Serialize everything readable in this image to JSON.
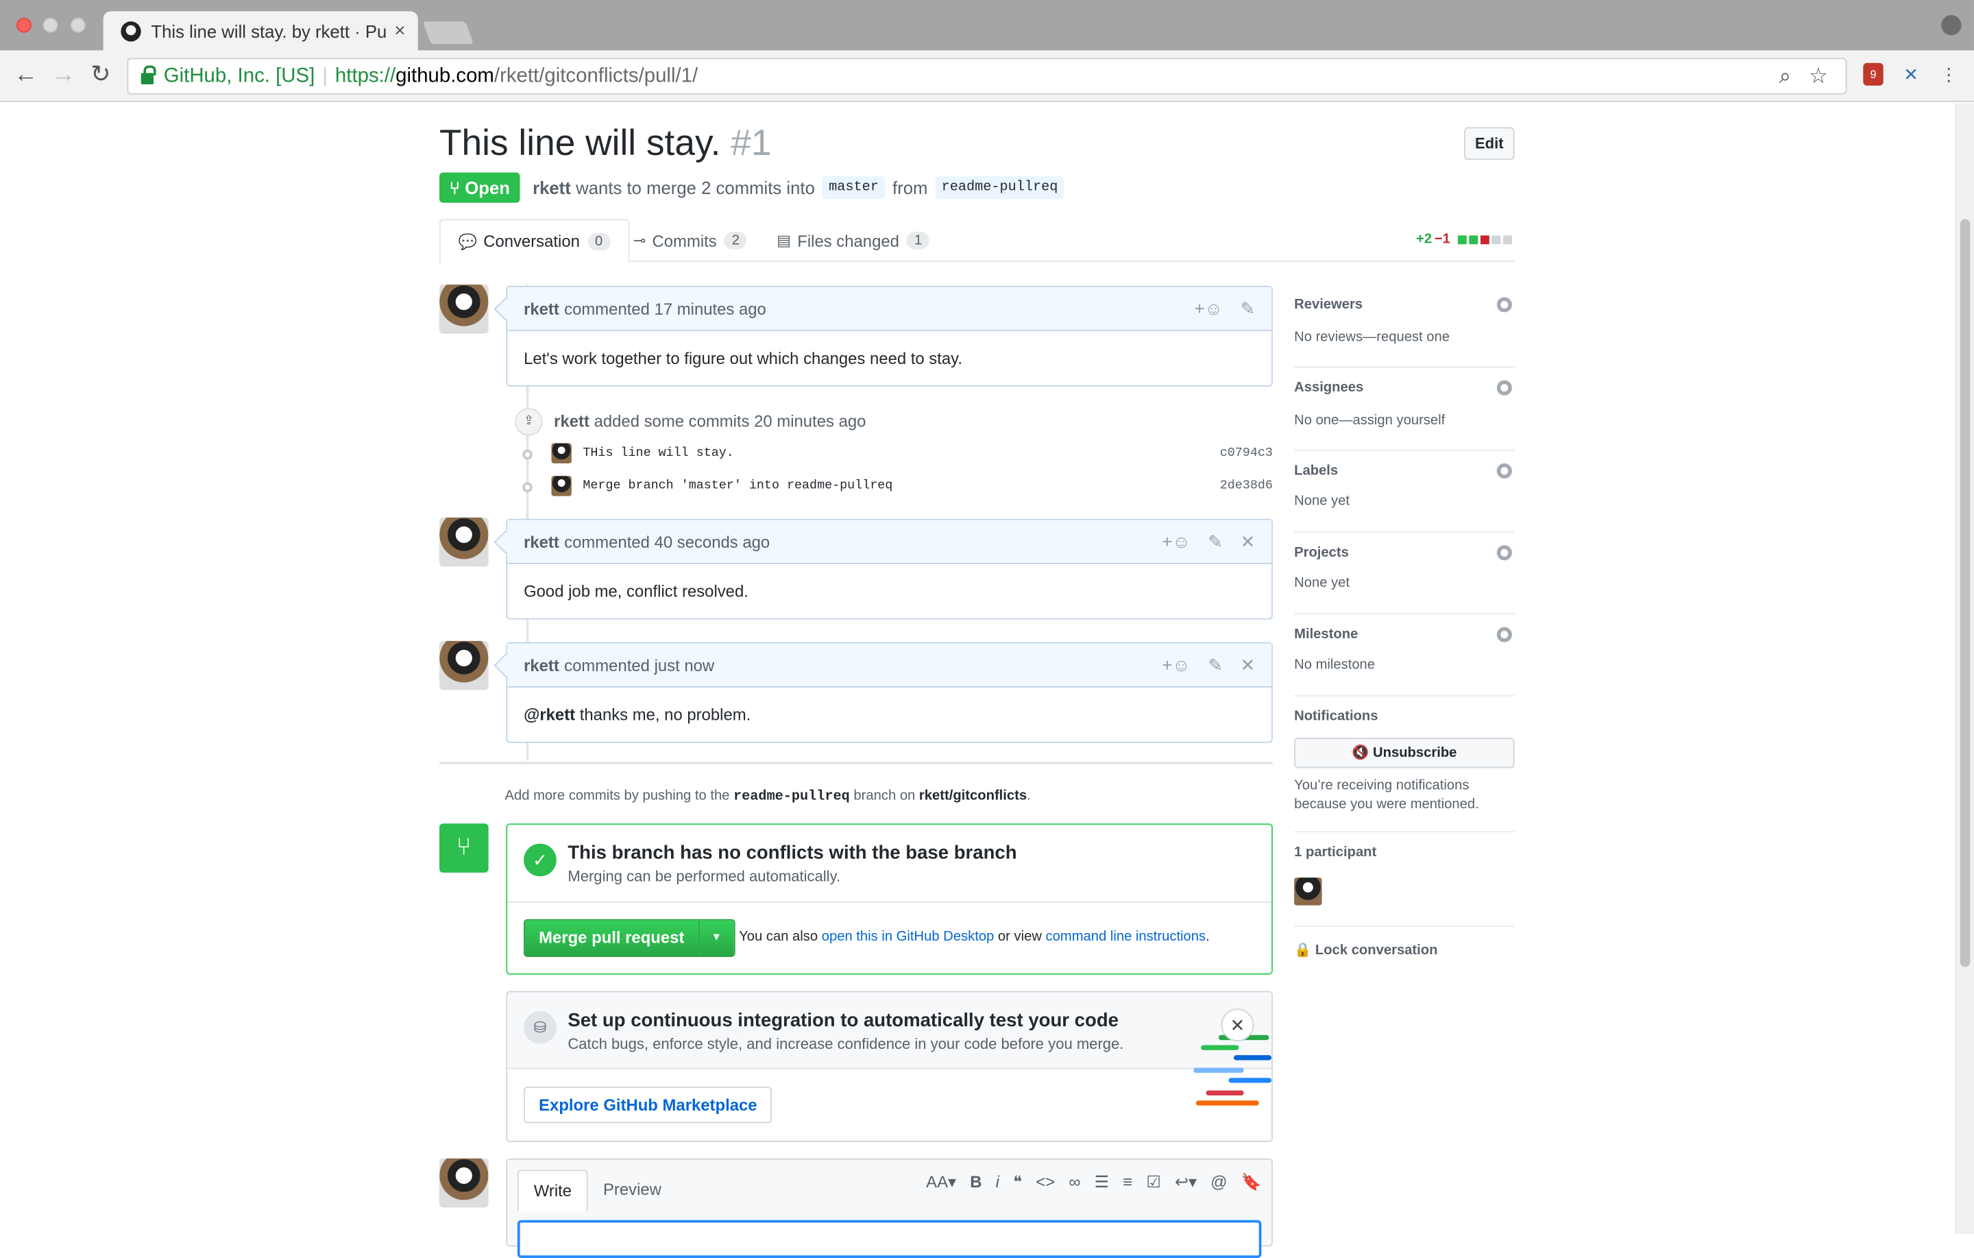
{
  "browser": {
    "tab_title": "This line will stay. by rkett · Pul",
    "tab_close": "×",
    "secure_label": "GitHub, Inc. [US]",
    "url_scheme": "https://",
    "url_host": "github.com",
    "url_path": "/rkett/gitconflicts/pull/1/",
    "ext_badge": "9"
  },
  "pr": {
    "title": "This line will stay.",
    "number": "#1",
    "edit_label": "Edit",
    "state": "Open",
    "author": "rkett",
    "merge_text": "wants to merge 2 commits into",
    "base_branch": "master",
    "from_text": "from",
    "head_branch": "readme-pullreq"
  },
  "tabs": [
    {
      "label": "Conversation",
      "count": "0"
    },
    {
      "label": "Commits",
      "count": "2"
    },
    {
      "label": "Files changed",
      "count": "1"
    }
  ],
  "diffstat": {
    "additions": "+2",
    "deletions": "−1"
  },
  "comments": [
    {
      "author": "rkett",
      "meta": "commented 17 minutes ago",
      "body": "Let's work together to figure out which changes need to stay."
    },
    {
      "author": "rkett",
      "meta": "commented 40 seconds ago",
      "body": "Good job me, conflict resolved."
    },
    {
      "author": "rkett",
      "meta": "commented just now",
      "mention": "@rkett",
      "body": " thanks me, no problem."
    }
  ],
  "commits": {
    "author": "rkett",
    "summary": "added some commits 20 minutes ago",
    "items": [
      {
        "message": "THis line will stay.",
        "sha": "c0794c3"
      },
      {
        "message": "Merge branch 'master' into readme-pullreq",
        "sha": "2de38d6"
      }
    ]
  },
  "push_note": {
    "prefix": "Add more commits by pushing to the",
    "branch": "readme-pullreq",
    "middle": "branch on",
    "repo": "rkett/gitconflicts",
    "suffix": "."
  },
  "merge": {
    "heading": "This branch has no conflicts with the base branch",
    "sub": "Merging can be performed automatically.",
    "button": "Merge pull request",
    "alt_prefix": "You can also",
    "alt_link1": "open this in GitHub Desktop",
    "alt_middle": "or view",
    "alt_link2": "command line instructions",
    "alt_suffix": "."
  },
  "ci": {
    "heading": "Set up continuous integration to automatically test your code",
    "sub": "Catch bugs, enforce style, and increase confidence in your code before you merge.",
    "button": "Explore GitHub Marketplace"
  },
  "composer": {
    "write_tab": "Write",
    "preview_tab": "Preview"
  },
  "sidebar": {
    "reviewers": {
      "heading": "Reviewers",
      "value": "No reviews—request one"
    },
    "assignees": {
      "heading": "Assignees",
      "value": "No one—assign yourself"
    },
    "labels": {
      "heading": "Labels",
      "value": "None yet"
    },
    "projects": {
      "heading": "Projects",
      "value": "None yet"
    },
    "milestone": {
      "heading": "Milestone",
      "value": "No milestone"
    },
    "notifications": {
      "heading": "Notifications",
      "button": "Unsubscribe",
      "reason": "You’re receiving notifications because you were mentioned."
    },
    "participants": {
      "heading": "1 participant"
    },
    "lock": "Lock conversation"
  },
  "colors": {
    "success": "#2cbe4e",
    "link": "#0366d6",
    "comment_header": "#f1f8ff"
  }
}
